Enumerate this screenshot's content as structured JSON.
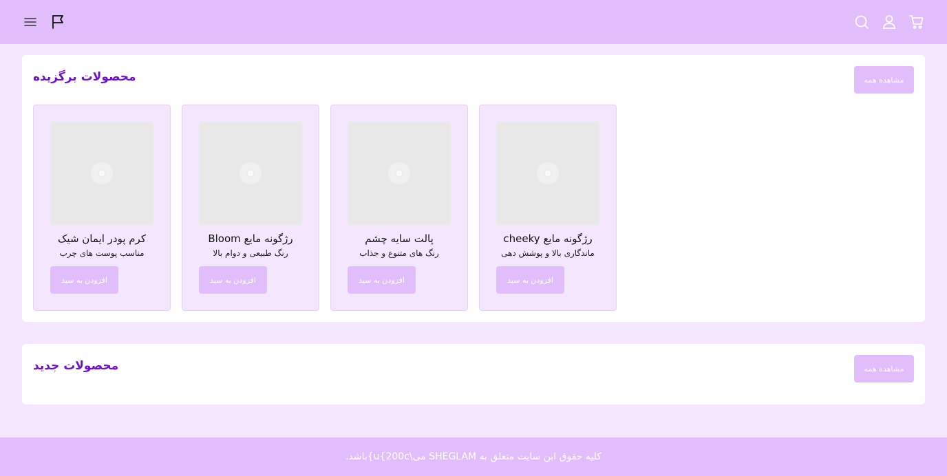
{
  "header": {
    "icons": [
      "menu-icon",
      "flag-icon",
      "search-icon",
      "user-icon",
      "cart-icon"
    ]
  },
  "featured": {
    "title": "محصولات برگزیده",
    "view_all": "مشاهده همه",
    "products": [
      {
        "name": "رژگونه مایع cheeky",
        "desc": "ماندگاری بالا و پوشش دهی",
        "add": "افزودن به سبد"
      },
      {
        "name": "پالت سایه چشم",
        "desc": "رنگ های متنوع و جذاب",
        "add": "افزودن به سبد"
      },
      {
        "name": "رژگونه مایع Bloom",
        "desc": "رنگ طبیعی و دوام بالا",
        "add": "افزودن به سبد"
      },
      {
        "name": "کرم پودر ایمان شیک",
        "desc": "مناسب پوست های چرب",
        "add": "افزودن به سبد"
      }
    ]
  },
  "new_products": {
    "title": "محصولات جدید",
    "view_all": "مشاهده همه"
  },
  "footer": {
    "text": ".باشد{u{200c\\می SHEGLAM کلیه حقوق این سایت متعلق به"
  },
  "colors": {
    "header_bg": "#e1bdfc",
    "page_bg": "#f3e6fd",
    "title": "#6e0fd3",
    "button": "#e1bdfc"
  }
}
